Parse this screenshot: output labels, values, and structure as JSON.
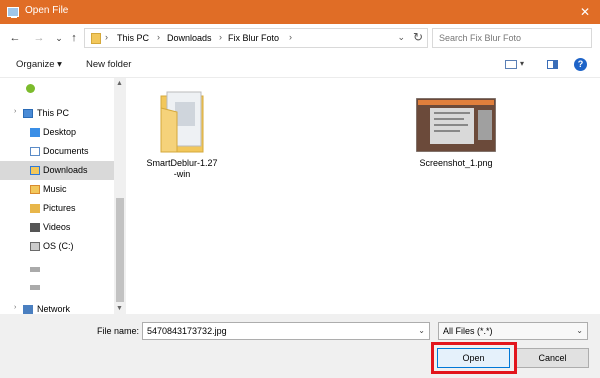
{
  "window": {
    "title": "Open File",
    "close_glyph": "✕"
  },
  "nav": {
    "back_glyph": "←",
    "forward_glyph": "→",
    "recent_glyph": "⌄",
    "up_glyph": "↑",
    "breadcrumbs": [
      "This PC",
      "Downloads",
      "Fix Blur Foto"
    ],
    "crumb_sep": "›",
    "dropdown_glyph": "⌄",
    "refresh_glyph": "↻",
    "search_placeholder": "Search Fix Blur Foto"
  },
  "toolbar": {
    "organize_label": "Organize ▾",
    "new_folder_label": "New folder",
    "view_dropdown_glyph": "▾",
    "help_label": "?"
  },
  "sidebar": {
    "items": [
      {
        "label": "",
        "icon": "onedrive-icon",
        "color": "#7cbb2c"
      },
      {
        "label": "This PC",
        "icon": "computer-icon",
        "color": "#4a8bd6"
      },
      {
        "label": "Desktop",
        "icon": "desktop-icon",
        "color": "#3a8ee6"
      },
      {
        "label": "Documents",
        "icon": "documents-icon",
        "color": "#5b8bc7"
      },
      {
        "label": "Downloads",
        "icon": "downloads-icon",
        "color": "#2f7ad9"
      },
      {
        "label": "Music",
        "icon": "music-icon",
        "color": "#d98b2f"
      },
      {
        "label": "Pictures",
        "icon": "pictures-icon",
        "color": "#e8b64a"
      },
      {
        "label": "Videos",
        "icon": "videos-icon",
        "color": "#555555"
      },
      {
        "label": "OS (C:)",
        "icon": "drive-icon",
        "color": "#6a6a6a"
      },
      {
        "label": "",
        "icon": "removable-drive-icon",
        "color": "#888888"
      },
      {
        "label": "",
        "icon": "removable-drive-icon",
        "color": "#888888"
      },
      {
        "label": "Network",
        "icon": "network-icon",
        "color": "#4a7fc0"
      }
    ],
    "selected_index": 4
  },
  "files": [
    {
      "name": "SmartDeblur-1.27-win",
      "name_line1": "SmartDeblur-1.27",
      "name_line2": "-win",
      "type": "folder"
    },
    {
      "name": "Screenshot_1.png",
      "type": "image"
    }
  ],
  "bottom": {
    "filename_label": "File name:",
    "filename_value": "5470843173732.jpg",
    "filter_value": "All Files (*.*)",
    "open_label": "Open",
    "cancel_label": "Cancel",
    "highlight_color": "#e2151c"
  },
  "colors": {
    "titlebar": "#e06d26",
    "accent": "#0078d7",
    "selection": "#d9d9d9"
  }
}
